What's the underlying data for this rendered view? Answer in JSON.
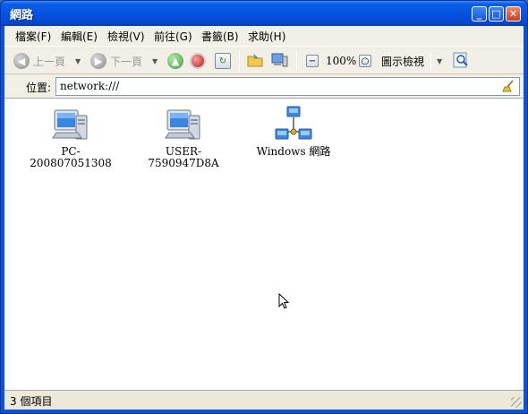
{
  "window": {
    "title": "網路"
  },
  "titlebar": {
    "minimize": "_",
    "maximize": "□",
    "close": "✕"
  },
  "menu": [
    {
      "label": "檔案(F)"
    },
    {
      "label": "編輯(E)"
    },
    {
      "label": "檢視(V)"
    },
    {
      "label": "前往(G)"
    },
    {
      "label": "書籤(B)"
    },
    {
      "label": "求助(H)"
    }
  ],
  "toolbar": {
    "back_label": "上一頁",
    "forward_label": "下一頁",
    "zoom": "100%",
    "view_mode": "圖示檢視"
  },
  "address": {
    "label": "位置:",
    "value": "network:///"
  },
  "items": [
    {
      "label": "PC-200807051308",
      "icon": "computer-icon"
    },
    {
      "label": "USER-7590947D8A",
      "icon": "computer-icon"
    },
    {
      "label": "Windows 網路",
      "icon": "network-icon"
    }
  ],
  "status": {
    "text": "3 個項目"
  },
  "colors": {
    "titlebar": "#0554e0",
    "chrome": "#ece9d8",
    "content": "#ffffff"
  }
}
